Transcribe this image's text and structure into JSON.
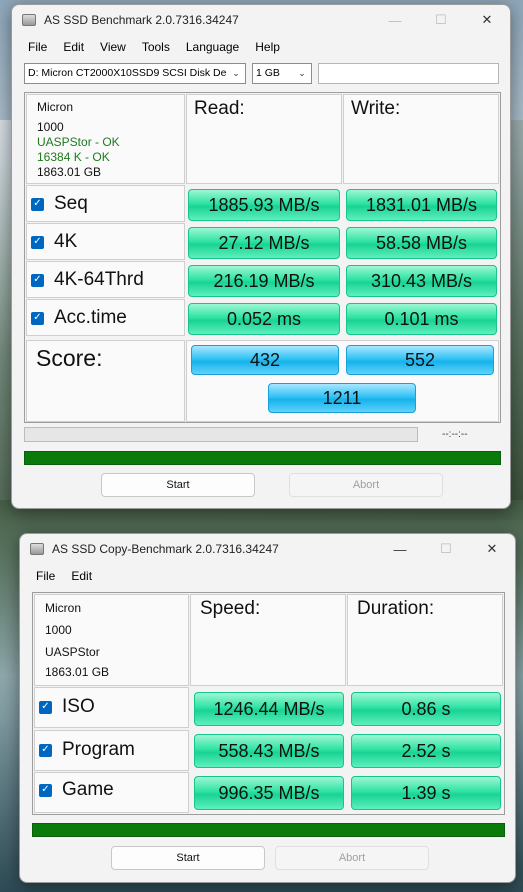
{
  "bench": {
    "title": "AS SSD Benchmark 2.0.7316.34247",
    "menu": [
      "File",
      "Edit",
      "View",
      "Tools",
      "Language",
      "Help"
    ],
    "drive_select": "D: Micron CT2000X10SSD9 SCSI Disk De",
    "size_select": "1 GB",
    "info": {
      "vendor": "Micron",
      "firmware": "1000",
      "driver_status": "UASPStor - OK",
      "align_status": "16384 K - OK",
      "capacity": "1863.01 GB"
    },
    "read_label": "Read:",
    "write_label": "Write:",
    "rows": [
      {
        "label": "Seq",
        "read": "1885.93 MB/s",
        "write": "1831.01 MB/s"
      },
      {
        "label": "4K",
        "read": "27.12 MB/s",
        "write": "58.58 MB/s"
      },
      {
        "label": "4K-64Thrd",
        "read": "216.19 MB/s",
        "write": "310.43 MB/s"
      },
      {
        "label": "Acc.time",
        "read": "0.052 ms",
        "write": "0.101 ms"
      }
    ],
    "score_label": "Score:",
    "score_read": "432",
    "score_write": "552",
    "score_total": "1211",
    "timer": "--:--:--",
    "progress_fraction": 1.0,
    "start_label": "Start",
    "abort_label": "Abort"
  },
  "copy": {
    "title": "AS SSD Copy-Benchmark 2.0.7316.34247",
    "menu": [
      "File",
      "Edit"
    ],
    "info": {
      "vendor": "Micron",
      "firmware": "1000",
      "driver": "UASPStor",
      "capacity": "1863.01 GB"
    },
    "speed_label": "Speed:",
    "duration_label": "Duration:",
    "rows": [
      {
        "label": "ISO",
        "speed": "1246.44 MB/s",
        "duration": "0.86 s"
      },
      {
        "label": "Program",
        "speed": "558.43 MB/s",
        "duration": "2.52 s"
      },
      {
        "label": "Game",
        "speed": "996.35 MB/s",
        "duration": "1.39 s"
      }
    ],
    "progress_fraction": 1.0,
    "start_label": "Start",
    "abort_label": "Abort"
  },
  "window_controls": {
    "minimize": "—",
    "maximize": "☐",
    "close": "✕"
  },
  "colors": {
    "value_green": "#2ee3a3",
    "score_blue": "#34c3f5",
    "status_ok": "#1f7a1f",
    "progress_green": "#0a7a0a",
    "checkbox_blue": "#0067c0"
  }
}
